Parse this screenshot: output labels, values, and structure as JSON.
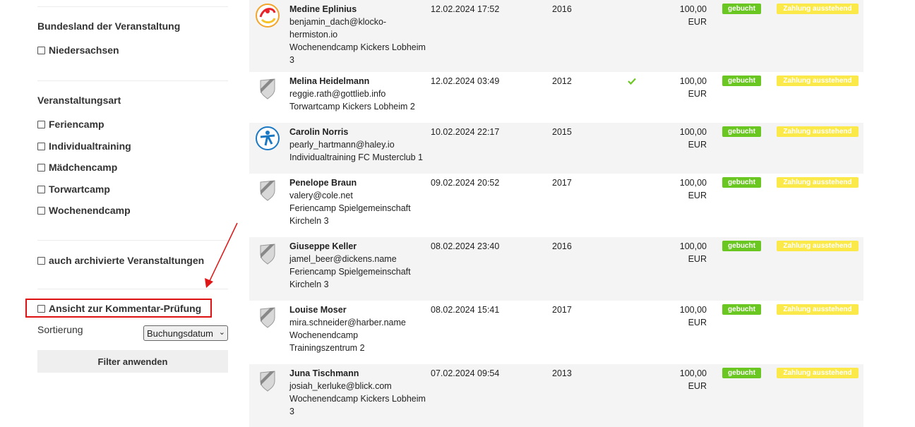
{
  "filters": {
    "bundesland_title": "Bundesland der Veranstaltung",
    "bundesland_options": [
      "Niedersachsen"
    ],
    "art_title": "Veranstaltungsart",
    "art_options": [
      "Feriencamp",
      "Individualtraining",
      "Mädchencamp",
      "Torwartcamp",
      "Wochenendcamp"
    ],
    "archived_label": "auch archivierte Veranstaltungen",
    "comment_review_label": "Ansicht zur Kommentar-Prüfung",
    "sort_label": "Sortierung",
    "sort_value": "Buchungsdatum",
    "apply_button": "Filter anwenden"
  },
  "colors": {
    "booked_badge": "#6ac722",
    "pending_badge": "#fbe94a",
    "highlight": "#dd1111",
    "check": "#6ac722"
  },
  "bookings": [
    {
      "name": "Medine Eplinius",
      "email": "benjamin_dach@klocko-",
      "email2": "hermiston.io",
      "event": "Wochenendcamp Kickers Lobheim",
      "event2": "3",
      "date": "12.02.2024 17:52",
      "year": "2016",
      "price": "100,00",
      "currency": "EUR",
      "status": "gebucht",
      "payment": "Zahlung ausstehend",
      "logo": "colorful-club-logo",
      "checked": false
    },
    {
      "name": "Melina Heidelmann",
      "email": "reggie.rath@gottlieb.info",
      "event": "Torwartcamp Kickers Lobheim 2",
      "date": "12.02.2024 03:49",
      "year": "2012",
      "price": "100,00",
      "currency": "EUR",
      "status": "gebucht",
      "payment": "Zahlung ausstehend",
      "logo": "shield-logo",
      "checked": true
    },
    {
      "name": "Carolin Norris",
      "email": "pearly_hartmann@haley.io",
      "event": "Individualtraining FC Musterclub 1",
      "date": "10.02.2024 22:17",
      "year": "2015",
      "price": "100,00",
      "currency": "EUR",
      "status": "gebucht",
      "payment": "Zahlung ausstehend",
      "logo": "blue-club-logo",
      "checked": false
    },
    {
      "name": "Penelope Braun",
      "email": "valery@cole.net",
      "event": "Feriencamp Spielgemeinschaft",
      "event2": "Kircheln 3",
      "date": "09.02.2024 20:52",
      "year": "2017",
      "price": "100,00",
      "currency": "EUR",
      "status": "gebucht",
      "payment": "Zahlung ausstehend",
      "logo": "shield-logo",
      "checked": false
    },
    {
      "name": "Giuseppe Keller",
      "email": "jamel_beer@dickens.name",
      "event": "Feriencamp Spielgemeinschaft",
      "event2": "Kircheln 3",
      "date": "08.02.2024 23:40",
      "year": "2016",
      "price": "100,00",
      "currency": "EUR",
      "status": "gebucht",
      "payment": "Zahlung ausstehend",
      "logo": "shield-logo",
      "checked": false
    },
    {
      "name": "Louise Moser",
      "email": "mira.schneider@harber.name",
      "event": "Wochenendcamp",
      "event2": "Trainingszentrum 2",
      "date": "08.02.2024 15:41",
      "year": "2017",
      "price": "100,00",
      "currency": "EUR",
      "status": "gebucht",
      "payment": "Zahlung ausstehend",
      "logo": "shield-logo",
      "checked": false
    },
    {
      "name": "Juna Tischmann",
      "email": "josiah_kerluke@blick.com",
      "event": "Wochenendcamp Kickers Lobheim",
      "event2": "3",
      "date": "07.02.2024 09:54",
      "year": "2013",
      "price": "100,00",
      "currency": "EUR",
      "status": "gebucht",
      "payment": "Zahlung ausstehend",
      "logo": "shield-logo",
      "checked": false
    }
  ]
}
